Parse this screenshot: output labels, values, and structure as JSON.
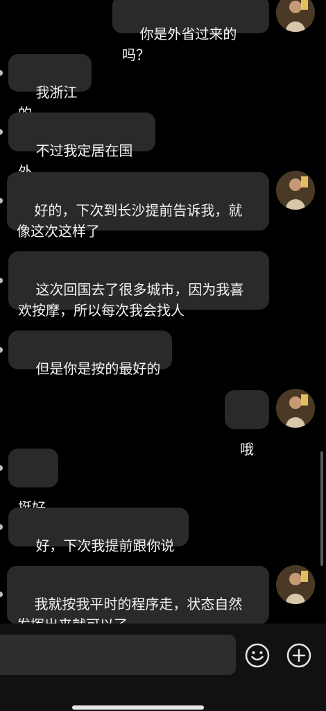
{
  "chat": {
    "messages": [
      {
        "side": "right",
        "text": "你是外省过来的吗？",
        "avatar": "contact-avatar"
      },
      {
        "side": "left",
        "text": "我浙江的"
      },
      {
        "side": "left",
        "text": "不过我定居在国外"
      },
      {
        "side": "left",
        "text": "好的，下次到长沙提前告诉我，就\n像这次这样了",
        "avatar": "contact-avatar"
      },
      {
        "side": "left",
        "text": "这次回国去了很多城市，因为我喜\n欢按摩，所以每次我会找人"
      },
      {
        "side": "left",
        "text": "但是你是按的最好的"
      },
      {
        "side": "right",
        "text": "哦",
        "avatar": "contact-avatar"
      },
      {
        "side": "left",
        "text": "挺好"
      },
      {
        "side": "left",
        "text": "好，下次我提前跟你说"
      },
      {
        "side": "left",
        "text": "我就按我平时的程序走，状态自然\n发挥出来就可以了",
        "avatar": "contact-avatar"
      }
    ]
  },
  "composer": {
    "input_value": "",
    "emoji_icon": "smiley-icon",
    "add_icon": "plus-circle-icon"
  },
  "colors": {
    "background": "#000000",
    "bubble": "#2a2a2a",
    "text": "#f2f2f2"
  }
}
